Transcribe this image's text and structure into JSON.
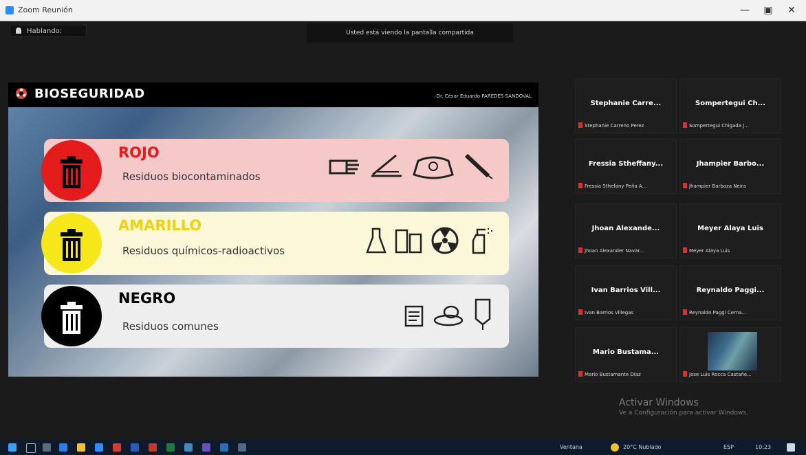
{
  "window": {
    "title": "Zoom Reunión"
  },
  "top": {
    "talking_label": "Hablando:",
    "banner_text": "Usted está viendo la pantalla compartida"
  },
  "slide": {
    "title": "BIOSEGURIDAD",
    "author": "Dr. César Eduardo PAREDES SANDOVAL",
    "categories": [
      {
        "name": "ROJO",
        "description": "Residuos biocontaminados",
        "color": "#e31b1b",
        "card_bg": "#f6c9c9",
        "icons": [
          "glove-hand-icon",
          "syringe-tray-icon",
          "biohazard-bag-icon",
          "syringe-icon"
        ]
      },
      {
        "name": "AMARILLO",
        "description": "Residuos químicos-radioactivos",
        "color": "#f5e71a",
        "card_bg": "#fbf7d9",
        "icons": [
          "chemical-bottle-icon",
          "containers-icon",
          "radioactive-icon",
          "spray-bottle-icon"
        ]
      },
      {
        "name": "NEGRO",
        "description": "Residuos comunes",
        "color": "#000000",
        "card_bg": "#eeeeee",
        "icons": [
          "paper-icon",
          "food-waste-icon",
          "iv-bag-icon"
        ]
      }
    ]
  },
  "participants": [
    {
      "name": "Stephanie Carre...",
      "label": "Stephanie Carreno Perez"
    },
    {
      "name": "Sompertegui Ch...",
      "label": "Sompertegui Chigada J..."
    },
    {
      "name": "Fressia Stheffany...",
      "label": "Fressia Sthefany Peña A..."
    },
    {
      "name": "Jhampier Barbo...",
      "label": "Jhampier Barboza Neira"
    },
    {
      "name": "Jhoan Alexande...",
      "label": "Jhoan Alexander Navar..."
    },
    {
      "name": "Meyer Alaya Luis",
      "label": "Meyer Alaya Luis"
    },
    {
      "name": "Ivan Barrios Vill...",
      "label": "Ivan Barrios Villegas"
    },
    {
      "name": "Reynaldo Paggi...",
      "label": "Reynaldo Paggi Cerna..."
    },
    {
      "name": "Mario Bustama...",
      "label": "Mario Bustamante Díaz"
    },
    {
      "name": "",
      "label": "Jose Luis Rocca Castañe..."
    }
  ],
  "watermark": {
    "line1": "Activar Windows",
    "line2": "Ve a Configuración para activar Windows."
  },
  "taskbar": {
    "language": "Ventana",
    "weather": "20°C Nublado",
    "time": "10:23",
    "date": "ESP"
  }
}
